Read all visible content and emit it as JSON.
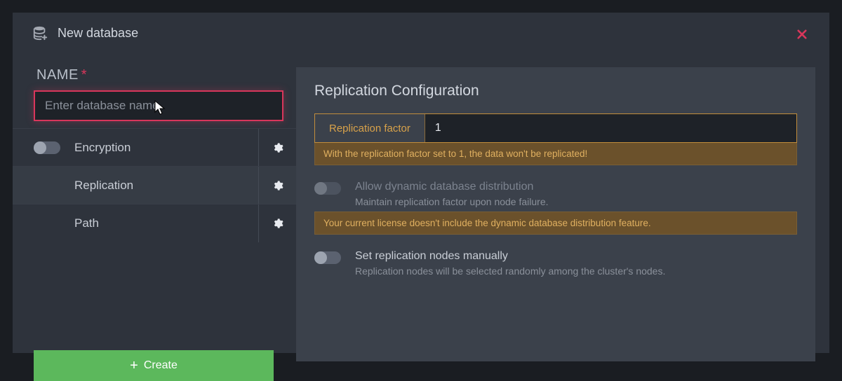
{
  "header": {
    "title": "New database"
  },
  "left": {
    "name_label": "NAME",
    "name_required_mark": "*",
    "name_placeholder": "Enter database name",
    "name_value": "",
    "options": {
      "encryption": "Encryption",
      "replication": "Replication",
      "path": "Path"
    },
    "create_label": "Create"
  },
  "right": {
    "title": "Replication Configuration",
    "rep_factor_label": "Replication factor",
    "rep_factor_value": "1",
    "rep_factor_warning": "With the replication factor set to 1, the data won't be replicated!",
    "allow_dynamic": {
      "title": "Allow dynamic database distribution",
      "sub": "Maintain replication factor upon node failure."
    },
    "license_warning": "Your current license doesn't include the dynamic database distribution feature.",
    "manual": {
      "title": "Set replication nodes manually",
      "sub": "Replication nodes will be selected randomly among the cluster's nodes."
    }
  }
}
